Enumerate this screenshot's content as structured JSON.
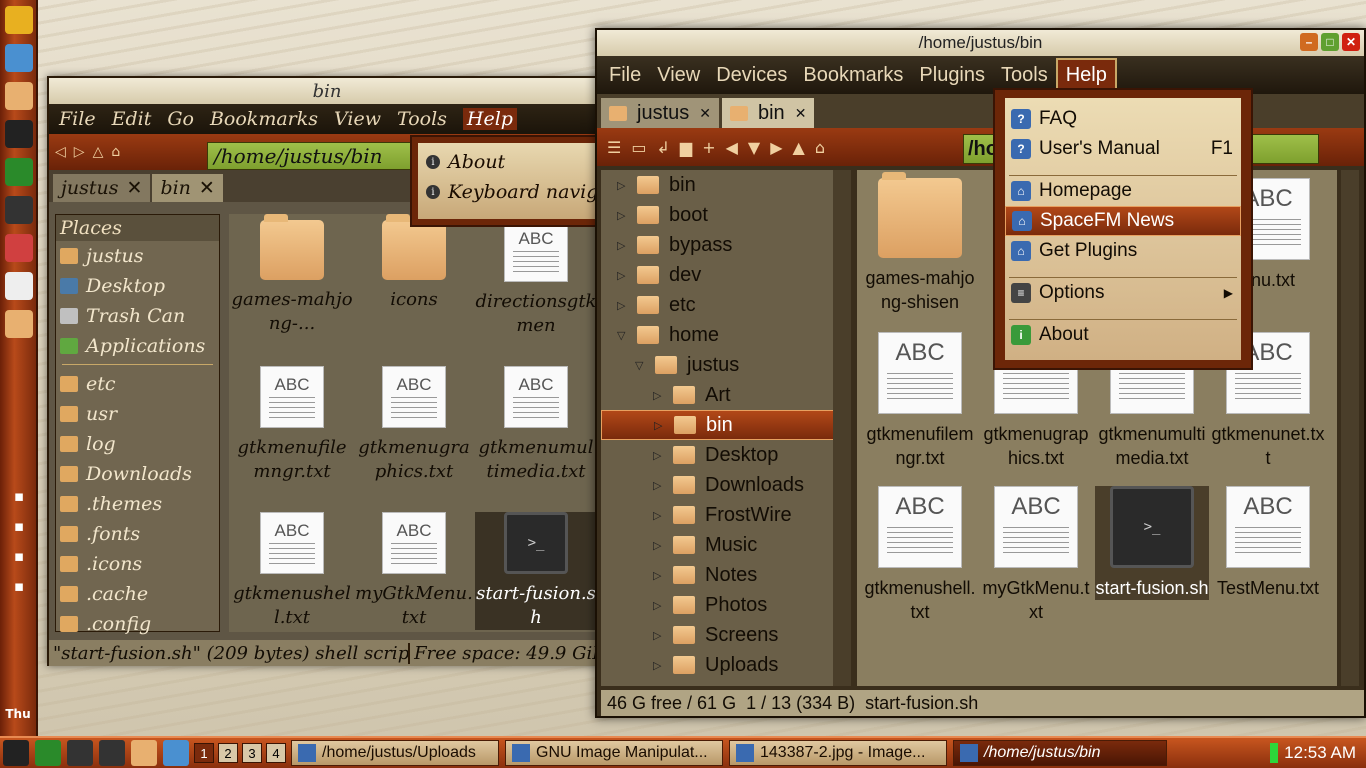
{
  "colors": {
    "accent": "#7a2a0c",
    "location_bar": "#9fbf4a",
    "selection": "#b24818"
  },
  "dock": {
    "icons": [
      "bird-icon",
      "network-icon",
      "folder-icon",
      "terminal-icon",
      "music-icon",
      "camera-icon",
      "cube-icon",
      "notepad-icon",
      "folder-icon"
    ],
    "tray_icons": [
      "volume-icon",
      "clipboard-icon",
      "network-icon",
      "battery-icon"
    ],
    "tray_label": "Thu"
  },
  "taskbar": {
    "workspaces": [
      "1",
      "2",
      "3",
      "4"
    ],
    "tasks": [
      {
        "label": "/home/justus/Uploads",
        "icon": "home-icon"
      },
      {
        "label": "GNU Image Manipulat...",
        "icon": "gimp-icon"
      },
      {
        "label": "143387-2.jpg - Image...",
        "icon": "eye-icon"
      },
      {
        "label": "/home/justus/bin",
        "icon": "home-icon"
      }
    ],
    "clock": "12:53 AM"
  },
  "win1": {
    "title": "bin",
    "menu": [
      "File",
      "Edit",
      "Go",
      "Bookmarks",
      "View",
      "Tools",
      "Help"
    ],
    "location": "/home/justus/bin",
    "tabs": [
      "justus",
      "bin"
    ],
    "places_header": "Places",
    "places": [
      "justus",
      "Desktop",
      "Trash Can",
      "Applications"
    ],
    "bookmarks": [
      "etc",
      "usr",
      "log",
      "Downloads",
      ".themes",
      ".fonts",
      ".icons",
      ".cache",
      ".config"
    ],
    "items": [
      {
        "name": "games-mahjong-...",
        "type": "folder"
      },
      {
        "name": "icons",
        "type": "folder"
      },
      {
        "name": "directionsgtkmen",
        "type": "doc"
      },
      {
        "name": "gtkmenufilemngr.txt",
        "type": "doc"
      },
      {
        "name": "gtkmenugraphics.txt",
        "type": "doc"
      },
      {
        "name": "gtkmenumultimedia.txt",
        "type": "doc"
      },
      {
        "name": "gtkmenushell.txt",
        "type": "doc"
      },
      {
        "name": "myGtkMenu.txt",
        "type": "doc"
      },
      {
        "name": "start-fusion.sh",
        "type": "term"
      }
    ],
    "doc_label": "ABC",
    "term_label": ">_",
    "help_menu": [
      "About",
      "Keyboard navig"
    ],
    "status": [
      "\"start-fusion.sh\" (209 bytes) shell script",
      "Free space: 49.9 GiB"
    ]
  },
  "win2": {
    "title": "/home/justus/bin",
    "menu": [
      "File",
      "View",
      "Devices",
      "Bookmarks",
      "Plugins",
      "Tools",
      "Help"
    ],
    "tabs": [
      "justus",
      "bin"
    ],
    "location": "/ho",
    "tree": [
      {
        "label": "bin",
        "depth": 0,
        "arrow": "▷"
      },
      {
        "label": "boot",
        "depth": 0,
        "arrow": "▷"
      },
      {
        "label": "bypass",
        "depth": 0,
        "arrow": "▷"
      },
      {
        "label": "dev",
        "depth": 0,
        "arrow": "▷"
      },
      {
        "label": "etc",
        "depth": 0,
        "arrow": "▷"
      },
      {
        "label": "home",
        "depth": 0,
        "arrow": "▽"
      },
      {
        "label": "justus",
        "depth": 1,
        "arrow": "▽"
      },
      {
        "label": "Art",
        "depth": 2,
        "arrow": "▷"
      },
      {
        "label": "bin",
        "depth": 2,
        "arrow": "▷",
        "selected": true
      },
      {
        "label": "Desktop",
        "depth": 2,
        "arrow": "▷"
      },
      {
        "label": "Downloads",
        "depth": 2,
        "arrow": "▷"
      },
      {
        "label": "FrostWire",
        "depth": 2,
        "arrow": "▷"
      },
      {
        "label": "Music",
        "depth": 2,
        "arrow": "▷"
      },
      {
        "label": "Notes",
        "depth": 2,
        "arrow": "▷"
      },
      {
        "label": "Photos",
        "depth": 2,
        "arrow": "▷"
      },
      {
        "label": "Screens",
        "depth": 2,
        "arrow": "▷"
      },
      {
        "label": "Uploads",
        "depth": 2,
        "arrow": "▷"
      }
    ],
    "items": [
      {
        "name": "games-mahjong-shisen",
        "type": "folder"
      },
      {
        "name": "",
        "type": "folder"
      },
      {
        "name": "",
        "type": "doc"
      },
      {
        "name": "enu.txt",
        "type": "doc"
      },
      {
        "name": "gtkmenufilemngr.txt",
        "type": "doc"
      },
      {
        "name": "gtkmenugraphics.txt",
        "type": "doc"
      },
      {
        "name": "gtkmenumultimedia.txt",
        "type": "doc"
      },
      {
        "name": "gtkmenunet.txt",
        "type": "doc"
      },
      {
        "name": "gtkmenushell.txt",
        "type": "doc"
      },
      {
        "name": "myGtkMenu.txt",
        "type": "doc"
      },
      {
        "name": "start-fusion.sh",
        "type": "term"
      },
      {
        "name": "TestMenu.txt",
        "type": "doc"
      }
    ],
    "doc_label": "ABC",
    "term_label": ">_",
    "help_menu": [
      {
        "label": "FAQ",
        "icon": "question-icon",
        "glyph": "?"
      },
      {
        "label": "User's Manual",
        "icon": "question-icon",
        "glyph": "?",
        "accel": "F1"
      },
      {
        "sep": true
      },
      {
        "label": "Homepage",
        "icon": "home-icon",
        "glyph": "⌂"
      },
      {
        "label": "SpaceFM News",
        "icon": "home-icon",
        "glyph": "⌂",
        "selected": true
      },
      {
        "label": "Get Plugins",
        "icon": "home-icon",
        "glyph": "⌂"
      },
      {
        "sep": true
      },
      {
        "label": "Options",
        "icon": "list-icon",
        "glyph": "≡",
        "submenu": "▶"
      },
      {
        "sep": true
      },
      {
        "label": "About",
        "icon": "info-icon",
        "glyph": "i"
      }
    ],
    "status": {
      "free": "46 G free / 61 G",
      "count": "1 / 13 (334 B)",
      "selected": "start-fusion.sh"
    }
  }
}
